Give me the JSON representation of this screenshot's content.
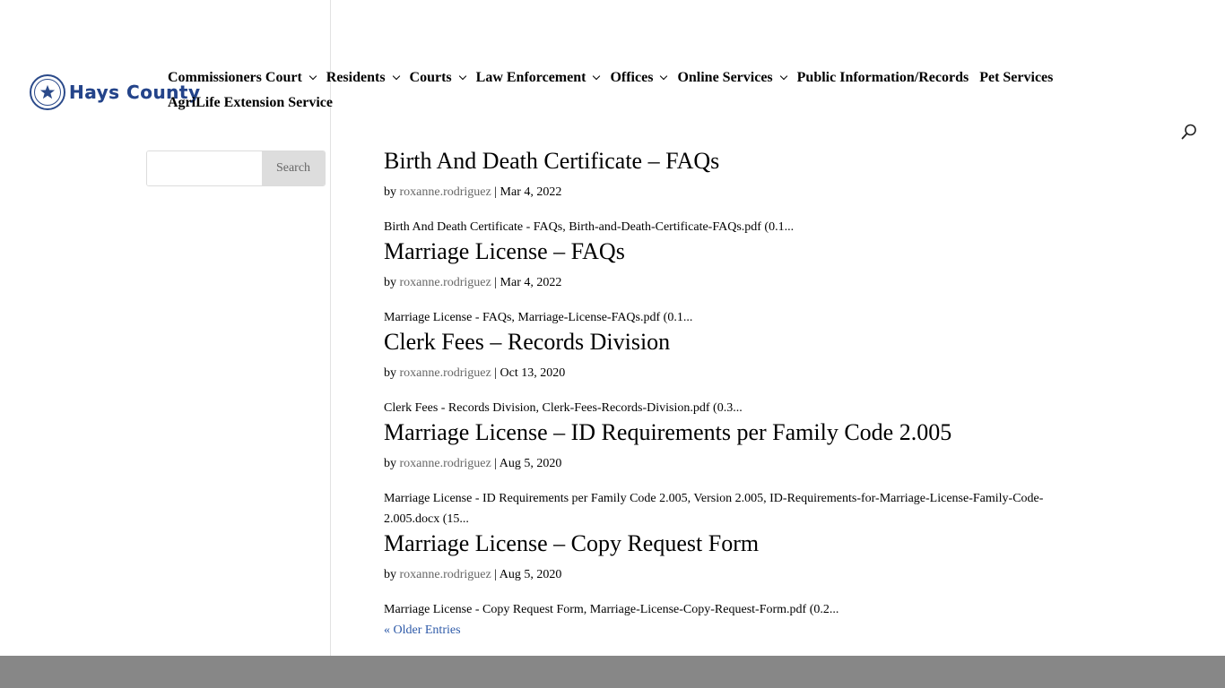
{
  "header": {
    "logo_text": "Hays County",
    "nav": [
      {
        "label": "Commissioners Court",
        "dropdown": true
      },
      {
        "label": "Residents",
        "dropdown": true
      },
      {
        "label": "Courts",
        "dropdown": true
      },
      {
        "label": "Law Enforcement",
        "dropdown": true
      },
      {
        "label": "Offices",
        "dropdown": true
      },
      {
        "label": "Online Services",
        "dropdown": true
      },
      {
        "label": "Public Information/Records",
        "dropdown": false
      },
      {
        "label": "Pet Services",
        "dropdown": false
      },
      {
        "label": "AgriLife Extension Service",
        "dropdown": false
      }
    ],
    "search_icon": "search-icon"
  },
  "sidebar": {
    "search_placeholder": "",
    "search_button": "Search"
  },
  "posts": [
    {
      "title": "Birth And Death Certificate – FAQs",
      "by": "by",
      "author": "roxanne.rodriguez",
      "date": "Mar 4, 2022",
      "excerpt": "Birth And Death Certificate - FAQs, Birth-and-Death-Certificate-FAQs.pdf (0.1..."
    },
    {
      "title": "Marriage License – FAQs",
      "by": "by",
      "author": "roxanne.rodriguez",
      "date": "Mar 4, 2022",
      "excerpt": "Marriage License - FAQs, Marriage-License-FAQs.pdf (0.1..."
    },
    {
      "title": "Clerk Fees – Records Division",
      "by": "by",
      "author": "roxanne.rodriguez",
      "date": "Oct 13, 2020",
      "excerpt": "Clerk Fees - Records Division, Clerk-Fees-Records-Division.pdf (0.3..."
    },
    {
      "title": "Marriage License – ID Requirements per Family Code 2.005",
      "by": "by",
      "author": "roxanne.rodriguez",
      "date": "Aug 5, 2020",
      "excerpt": "Marriage License - ID Requirements per Family Code 2.005, Version 2.005, ID-Requirements-for-Marriage-License-Family-Code-2.005.docx (15..."
    },
    {
      "title": "Marriage License – Copy Request Form",
      "by": "by",
      "author": "roxanne.rodriguez",
      "date": "Aug 5, 2020",
      "excerpt": "Marriage License - Copy Request Form, Marriage-License-Copy-Request-Form.pdf (0.2..."
    }
  ],
  "pagination": {
    "older_label": "« Older Entries"
  },
  "colors": {
    "brand": "#24448a",
    "link": "#2e5aa8",
    "footer": "#878787"
  }
}
